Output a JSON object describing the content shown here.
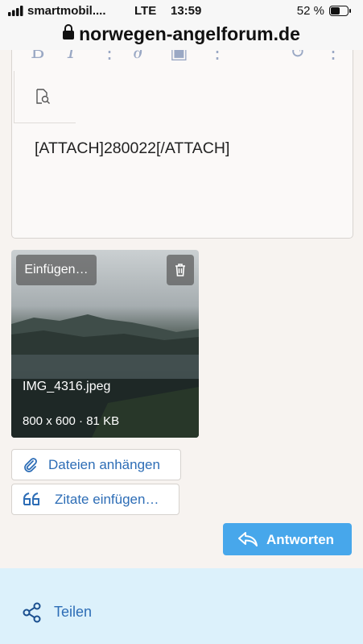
{
  "status_bar": {
    "carrier": "smartmobil....",
    "network": "LTE",
    "time": "13:59",
    "battery": "52 %",
    "battery_level_percent": 52
  },
  "browser": {
    "url": "norwegen-angelforum.de"
  },
  "editor": {
    "content": "[ATTACH]280022[/ATTACH]",
    "toolbar_icons": [
      "bold-icon",
      "italic-icon",
      "more-icon",
      "link-icon",
      "image-icon",
      "more-icon",
      "undo-icon",
      "more-icon",
      "preview-icon"
    ]
  },
  "attachment": {
    "insert_label": "Einfügen…",
    "filename": "IMG_4316.jpeg",
    "meta": "800 x 600 · 81 KB"
  },
  "actions": {
    "attach_files": "Dateien anhängen",
    "insert_quotes": "Zitate einfügen…",
    "reply": "Antworten"
  },
  "footer": {
    "share": "Teilen"
  },
  "colors": {
    "accent": "#47a7eb",
    "link": "#2d6db6",
    "share_bg": "#dcf1fb",
    "page_bg": "#f7f3f0"
  }
}
